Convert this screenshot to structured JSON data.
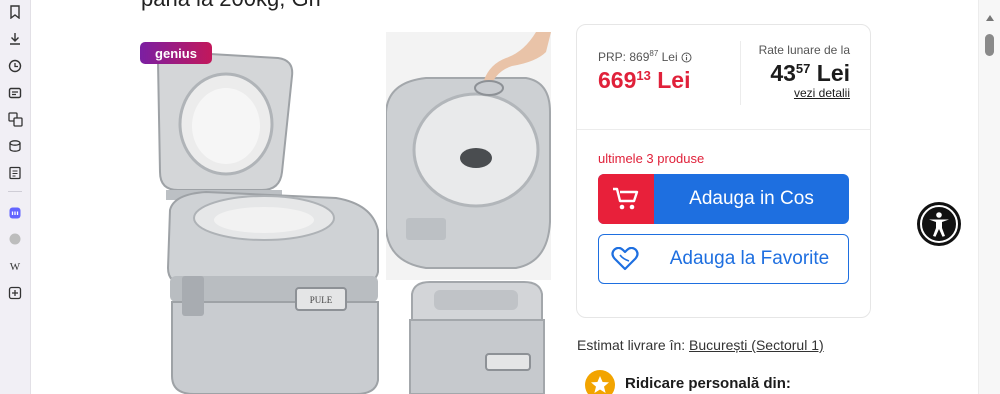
{
  "product": {
    "title_fragment": "pana la 200kg, Gri",
    "badge": "genius"
  },
  "price_card": {
    "prp_label": "PRP: 869",
    "prp_decimals": "87",
    "prp_currency": " Lei",
    "price_int": "669",
    "price_dec": "13",
    "price_currency": " Lei",
    "rate_label": "Rate lunare de la",
    "rate_int": "43",
    "rate_dec": "57",
    "rate_currency": " Lei",
    "rate_link": "vezi detalii",
    "stock_text": "ultimele 3 produse",
    "add_to_cart": "Adauga in Cos",
    "add_to_favorites": "Adauga la Favorite"
  },
  "delivery": {
    "label": "Estimat livrare în: ",
    "location": "București (Sectorul 1)",
    "pickup": "Ridicare personală din:"
  },
  "colors": {
    "price_red": "#e0213a",
    "primary_blue": "#1e6fe0",
    "pickup_yellow": "#f2a400"
  },
  "sidebar_icons": [
    "bookmark-icon",
    "download-icon",
    "history-icon",
    "wallet-icon",
    "translate-icon",
    "stack-icon",
    "notes-icon",
    "mastodon-icon",
    "globe-icon",
    "wikipedia-icon",
    "add-panel-icon"
  ]
}
